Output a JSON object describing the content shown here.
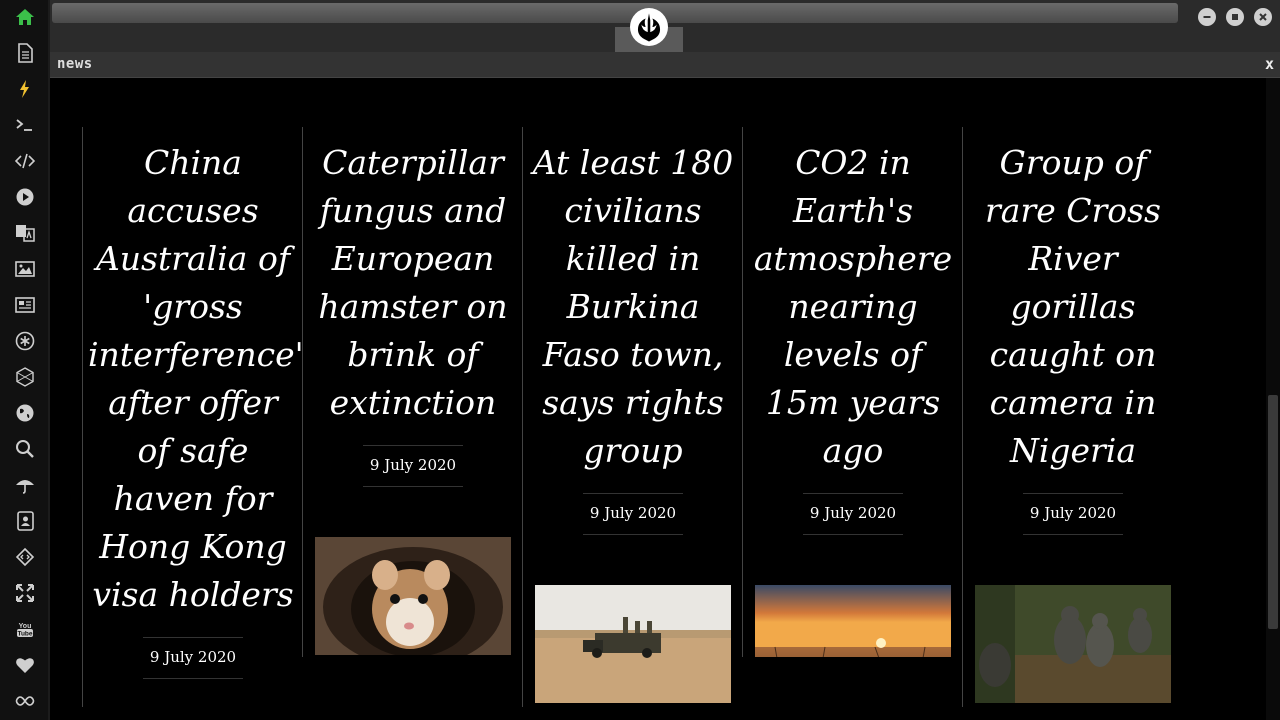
{
  "tab": {
    "title": "news",
    "close_label": "x"
  },
  "sidebar": {
    "items": [
      {
        "name": "home-icon",
        "color": "#3bbf4a"
      },
      {
        "name": "document-icon",
        "color": "#cfcfcf"
      },
      {
        "name": "lightning-icon",
        "color": "#f2c230"
      },
      {
        "name": "terminal-icon",
        "color": "#cfcfcf"
      },
      {
        "name": "code-icon",
        "color": "#cfcfcf"
      },
      {
        "name": "play-icon",
        "color": "#cfcfcf"
      },
      {
        "name": "translate-icon",
        "color": "#cfcfcf"
      },
      {
        "name": "image-icon",
        "color": "#cfcfcf"
      },
      {
        "name": "newspaper-icon",
        "color": "#cfcfcf"
      },
      {
        "name": "asterisk-icon",
        "color": "#cfcfcf"
      },
      {
        "name": "hexagon-icon",
        "color": "#cfcfcf"
      },
      {
        "name": "globe-icon",
        "color": "#cfcfcf"
      },
      {
        "name": "search-icon",
        "color": "#cfcfcf"
      },
      {
        "name": "umbrella-icon",
        "color": "#cfcfcf"
      },
      {
        "name": "contact-icon",
        "color": "#cfcfcf"
      },
      {
        "name": "diamond-code-icon",
        "color": "#cfcfcf"
      },
      {
        "name": "expand-icon",
        "color": "#cfcfcf"
      },
      {
        "name": "youtube-icon",
        "color": "#cfcfcf"
      },
      {
        "name": "heart-icon",
        "color": "#cfcfcf"
      },
      {
        "name": "infinity-icon",
        "color": "#cfcfcf"
      }
    ]
  },
  "window_controls": [
    "minimize-icon",
    "maximize-icon",
    "close-icon"
  ],
  "articles": [
    {
      "headline": "China accuses Australia of 'gross interference' after offer of safe haven for Hong Kong visa holders",
      "date": "9 July 2020",
      "image": "none"
    },
    {
      "headline": "Caterpillar fungus and European hamster on brink of extinction",
      "date": "9 July 2020",
      "image": "hamster-photo"
    },
    {
      "headline": "At least 180 civilians killed in Burkina Faso town, says rights group",
      "date": "9 July 2020",
      "image": "military-truck-photo"
    },
    {
      "headline": "CO2 in Earth's atmosphere nearing levels of 15m years ago",
      "date": "9 July 2020",
      "image": "sunset-desert-photo"
    },
    {
      "headline": "Group of rare Cross River gorillas caught on camera in Nigeria",
      "date": "9 July 2020",
      "image": "gorillas-photo"
    }
  ]
}
